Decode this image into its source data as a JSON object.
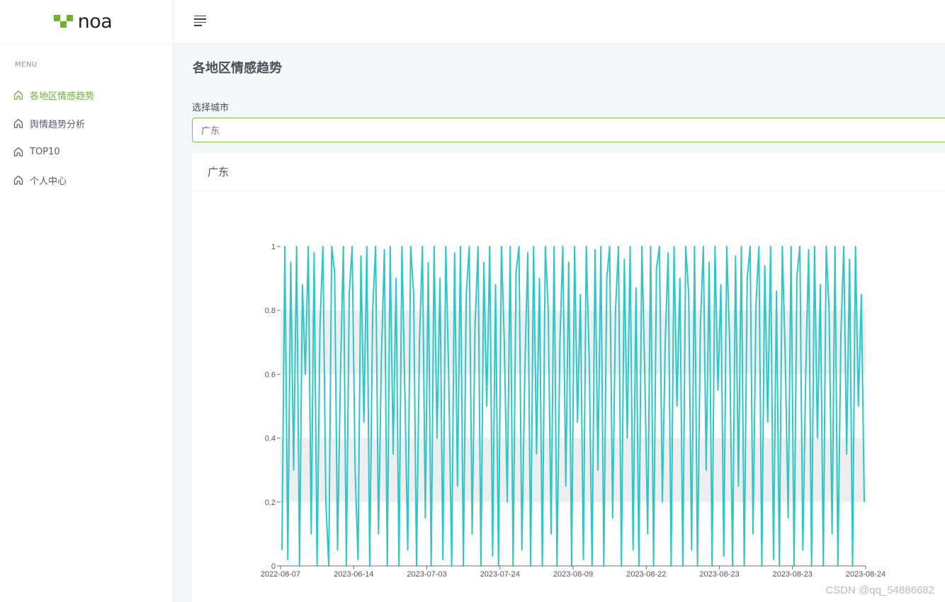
{
  "app": {
    "logo_text": "noa",
    "brand_color": "#6bb52a",
    "accent_color": "#6fb03b"
  },
  "sidebar": {
    "menu_title": "MENU",
    "items": [
      {
        "label": "各地区情感趋势",
        "icon": "home-icon",
        "active": true
      },
      {
        "label": "舆情趋势分析",
        "icon": "home-icon",
        "active": false
      },
      {
        "label": "TOP10",
        "icon": "home-icon",
        "active": false
      },
      {
        "label": "个人中心",
        "icon": "home-icon",
        "active": false
      }
    ]
  },
  "topbar": {
    "menu_icon": "hamburger-icon"
  },
  "main": {
    "page_title": "各地区情感趋势",
    "city_label": "选择城市",
    "city_value": "广东",
    "card_title": "广东"
  },
  "chart_data": {
    "type": "line",
    "title": "",
    "xlabel": "",
    "ylabel": "",
    "ylim": [
      0,
      1
    ],
    "y_ticks": [
      "0",
      "0.2",
      "0.4",
      "0.6",
      "0.8",
      "1"
    ],
    "x_tick_labels": [
      "2022-08-07",
      "2023-06-14",
      "2023-07-03",
      "2023-07-24",
      "2023-08-09",
      "2023-08-22",
      "2023-08-23",
      "2023-08-23",
      "2023-08-24"
    ],
    "line_color": "#2ec7c9",
    "split_area_colors": [
      "rgba(250,250,250,0.3)",
      "rgba(200,200,200,0.3)"
    ],
    "series": [
      {
        "values": [
          0.05,
          1,
          0.02,
          0.95,
          0.3,
          1,
          0.0,
          0.88,
          0.6,
          1,
          0.1,
          0.98,
          0.0,
          0.75,
          1,
          0.2,
          0.0,
          1,
          0.92,
          0.05,
          0.6,
          1,
          0.0,
          0.85,
          1,
          0.3,
          0.02,
          0.97,
          0.45,
          1,
          0.0,
          0.8,
          1,
          0.1,
          0.65,
          0.99,
          0.0,
          1,
          0.35,
          0.9,
          0.0,
          1,
          0.55,
          0.05,
          1,
          0.85,
          0.0,
          0.7,
          1,
          0.15,
          0.95,
          0.0,
          1,
          0.4,
          0.9,
          0.02,
          1,
          0.6,
          0.0,
          0.98,
          0.25,
          1,
          0.0,
          0.85,
          1,
          0.1,
          0.75,
          1,
          0.0,
          0.95,
          0.5,
          1,
          0.03,
          0.88,
          0.0,
          1,
          0.7,
          0.2,
          1,
          0.0,
          0.92,
          1,
          0.05,
          0.6,
          0.98,
          0.0,
          1,
          0.35,
          0.9,
          0.0,
          1,
          0.8,
          0.1,
          1,
          0.0,
          0.7,
          1,
          0.25,
          0.95,
          0.0,
          1,
          0.45,
          0.85,
          0.02,
          1,
          0.65,
          0.0,
          0.99,
          0.3,
          1,
          0.0,
          0.9,
          1,
          0.15,
          0.8,
          1,
          0.0,
          0.96,
          0.4,
          1,
          0.05,
          0.87,
          0.0,
          1,
          0.6,
          0.1,
          1,
          0.0,
          0.93,
          1,
          0.2,
          0.7,
          0.98,
          0.0,
          1,
          0.5,
          0.9,
          0.0,
          1,
          0.85,
          0.05,
          1,
          0.0,
          0.75,
          1,
          0.3,
          0.95,
          0.0,
          1,
          0.55,
          0.88,
          0.03,
          1,
          0.7,
          0.0,
          0.97,
          0.25,
          1,
          0.0,
          0.9,
          1,
          0.1,
          0.82,
          1,
          0.0,
          0.94,
          0.45,
          1,
          0.02,
          0.86,
          0.0,
          1,
          0.65,
          0.15,
          1,
          0.0,
          0.91,
          1,
          0.05,
          0.6,
          0.99,
          0.0,
          1,
          0.4,
          0.88,
          0.0,
          1,
          0.8,
          0.1,
          1,
          0.0,
          0.72,
          1,
          0.35,
          0.96,
          0.0,
          1,
          0.5,
          0.85,
          0.2
        ]
      }
    ]
  }
}
